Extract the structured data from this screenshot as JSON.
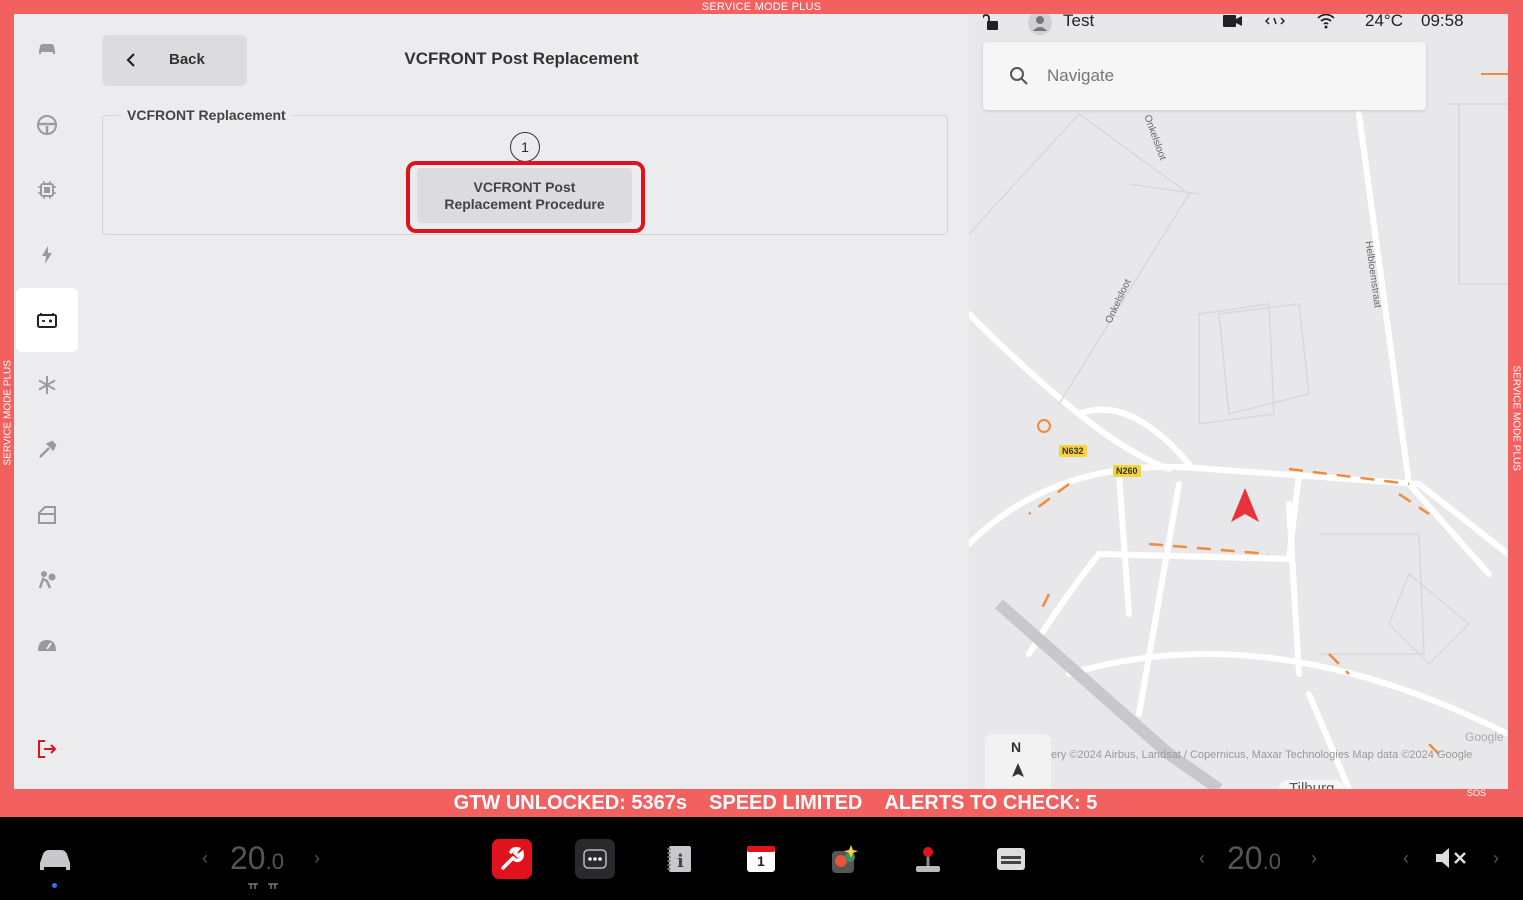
{
  "frame": {
    "top_label": "SERVICE MODE PLUS",
    "side_label": "SERVICE MODE PLUS",
    "color": "#f26060"
  },
  "sidebar": {
    "items": [
      {
        "icon": "car-icon"
      },
      {
        "icon": "steering-wheel-icon"
      },
      {
        "icon": "chip-icon"
      },
      {
        "icon": "lightning-icon"
      },
      {
        "icon": "battery-icon",
        "active": true
      },
      {
        "icon": "snowflake-icon"
      },
      {
        "icon": "wrench-icon"
      },
      {
        "icon": "door-icon"
      },
      {
        "icon": "airbag-icon"
      },
      {
        "icon": "gauge-icon"
      },
      {
        "icon": "exit-icon"
      }
    ]
  },
  "header": {
    "back_label": "Back",
    "title": "VCFRONT Post Replacement"
  },
  "group": {
    "legend": "VCFRONT Replacement",
    "step_number": "1",
    "procedure_label": "VCFRONT Post\nReplacement Procedure",
    "highlight_color": "#e0131d"
  },
  "map": {
    "status": {
      "profile_name": "Test",
      "temperature": "24°C",
      "time": "09:58"
    },
    "search_placeholder": "Navigate",
    "road_tags": [
      "N632",
      "N260"
    ],
    "streets": [
      "Onkelsloot",
      "Onkelsloot",
      "Helbloemstraat"
    ],
    "attribution": "ery ©2024 Airbus, Landsat / Copernicus, Maxar Technologies Map data ©2024 Google",
    "google_label": "Google",
    "city_label": "Tilburg",
    "compass_label": "N"
  },
  "alerts": {
    "gtw": "GTW UNLOCKED: 5367s",
    "speed": "SPEED LIMITED",
    "alerts": "ALERTS TO CHECK: 5",
    "sos": "SOS"
  },
  "taskbar": {
    "left_temp_main": "20",
    "left_temp_dec": ".0",
    "right_temp_main": "20",
    "right_temp_dec": ".0",
    "calendar_day": "1",
    "apps": [
      "service-wrench-icon",
      "more-dots-icon",
      "manual-icon",
      "calendar-icon",
      "toybox-icon",
      "joystick-icon",
      "energy-icon"
    ]
  }
}
